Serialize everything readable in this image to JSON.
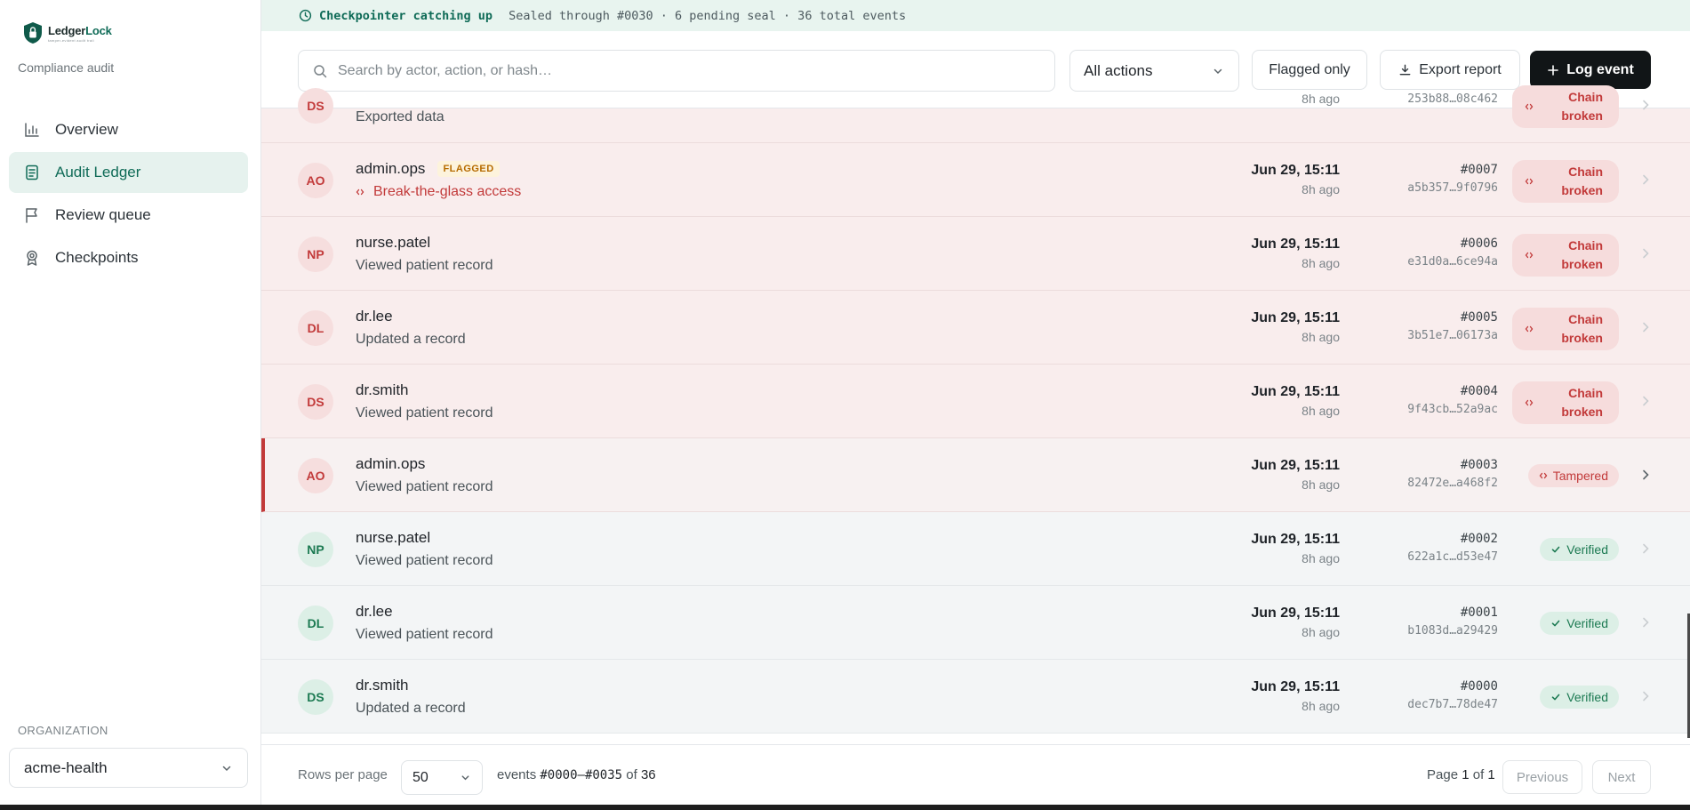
{
  "brand": {
    "name_a": "Ledger",
    "name_b": "Lock",
    "tagline": "tamper-evident audit trail"
  },
  "sidebar": {
    "subtitle": "Compliance audit",
    "items": [
      {
        "label": "Overview",
        "icon": "bar-chart-icon"
      },
      {
        "label": "Audit Ledger",
        "icon": "document-icon",
        "active": true
      },
      {
        "label": "Review queue",
        "icon": "flag-icon"
      },
      {
        "label": "Checkpoints",
        "icon": "badge-icon"
      }
    ],
    "org_label": "ORGANIZATION",
    "org_value": "acme-health"
  },
  "banner": {
    "status": "Checkpointer catching up",
    "detail": "Sealed through #0030 · 6 pending seal · 36 total events"
  },
  "toolbar": {
    "search_placeholder": "Search by actor, action, or hash…",
    "action_filter": "All actions",
    "flagged_label": "Flagged only",
    "export_label": "Export report",
    "log_label": "Log event"
  },
  "rows": [
    {
      "initials": "DS",
      "actor": "",
      "action": "Exported data",
      "date": "",
      "ago": "8h ago",
      "seq": "",
      "hash": "253b88…08c462",
      "status": "Chain broken",
      "kind": "broken",
      "flagged": false
    },
    {
      "initials": "AO",
      "actor": "admin.ops",
      "action": "Break-the-glass access",
      "date": "Jun 29, 15:11",
      "ago": "8h ago",
      "seq": "#0007",
      "hash": "a5b357…9f0796",
      "status": "Chain broken",
      "kind": "broken",
      "flagged": true,
      "flag_label": "FLAGGED"
    },
    {
      "initials": "NP",
      "actor": "nurse.patel",
      "action": "Viewed patient record",
      "date": "Jun 29, 15:11",
      "ago": "8h ago",
      "seq": "#0006",
      "hash": "e31d0a…6ce94a",
      "status": "Chain broken",
      "kind": "broken",
      "flagged": false
    },
    {
      "initials": "DL",
      "actor": "dr.lee",
      "action": "Updated a record",
      "date": "Jun 29, 15:11",
      "ago": "8h ago",
      "seq": "#0005",
      "hash": "3b51e7…06173a",
      "status": "Chain broken",
      "kind": "broken",
      "flagged": false
    },
    {
      "initials": "DS",
      "actor": "dr.smith",
      "action": "Viewed patient record",
      "date": "Jun 29, 15:11",
      "ago": "8h ago",
      "seq": "#0004",
      "hash": "9f43cb…52a9ac",
      "status": "Chain broken",
      "kind": "broken",
      "flagged": false
    },
    {
      "initials": "AO",
      "actor": "admin.ops",
      "action": "Viewed patient record",
      "date": "Jun 29, 15:11",
      "ago": "8h ago",
      "seq": "#0003",
      "hash": "82472e…a468f2",
      "status": "Tampered",
      "kind": "tampered",
      "flagged": false
    },
    {
      "initials": "NP",
      "actor": "nurse.patel",
      "action": "Viewed patient record",
      "date": "Jun 29, 15:11",
      "ago": "8h ago",
      "seq": "#0002",
      "hash": "622a1c…d53e47",
      "status": "Verified",
      "kind": "verified",
      "flagged": false
    },
    {
      "initials": "DL",
      "actor": "dr.lee",
      "action": "Viewed patient record",
      "date": "Jun 29, 15:11",
      "ago": "8h ago",
      "seq": "#0001",
      "hash": "b1083d…a29429",
      "status": "Verified",
      "kind": "verified",
      "flagged": false
    },
    {
      "initials": "DS",
      "actor": "dr.smith",
      "action": "Updated a record",
      "date": "Jun 29, 15:11",
      "ago": "8h ago",
      "seq": "#0000",
      "hash": "dec7b7…78de47",
      "status": "Verified",
      "kind": "verified",
      "flagged": false
    }
  ],
  "footer": {
    "rows_per_page_label": "Rows per page",
    "rows_per_page": "50",
    "range_prefix": "events",
    "range": "#0000–#0035",
    "range_of": "of",
    "total": "36",
    "page_label": "Page",
    "page": "1",
    "page_of": "of",
    "pages": "1",
    "prev_label": "Previous",
    "next_label": "Next"
  },
  "colors": {
    "brand": "#0f6b57",
    "danger": "#c23a3a",
    "success": "#1c7a52",
    "primary_button": "#111517"
  }
}
